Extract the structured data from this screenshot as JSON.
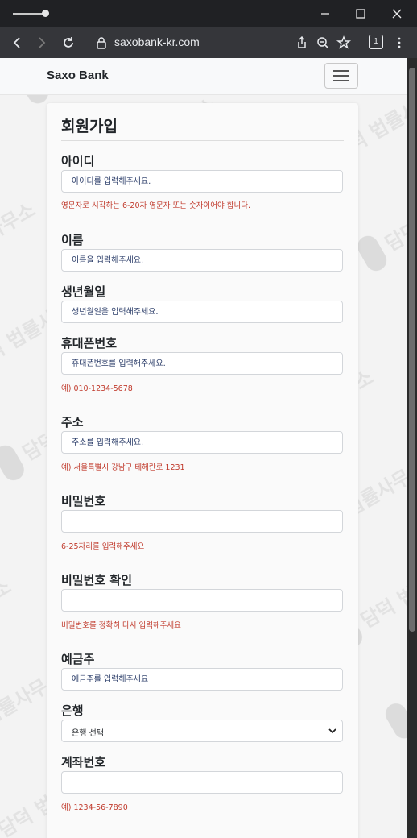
{
  "browser": {
    "url": "saxobank-kr.com",
    "tab_count": "1"
  },
  "navbar": {
    "brand": "Saxo Bank"
  },
  "form": {
    "title": "회원가입",
    "fields": {
      "userid": {
        "label": "아이디",
        "placeholder": "아이디를 입력해주세요.",
        "hint": "영문자로 시작하는 6-20자 영문자 또는 숫자이어야 합니다."
      },
      "name": {
        "label": "이름",
        "placeholder": "이름을 입력해주세요."
      },
      "birth": {
        "label": "생년월일",
        "placeholder": "생년월일을 입력해주세요."
      },
      "phone": {
        "label": "휴대폰번호",
        "placeholder": "휴대폰번호를 입력해주세요.",
        "hint": "예) 010-1234-5678"
      },
      "address": {
        "label": "주소",
        "placeholder": "주소를 입력해주세요.",
        "hint": "예) 서울특별시 강남구 테헤란로 1231"
      },
      "password": {
        "label": "비밀번호",
        "placeholder": "",
        "hint": "6-25자리를 입력해주세요"
      },
      "password_confirm": {
        "label": "비밀번호 확인",
        "placeholder": "",
        "hint": "비밀번호를 정확히 다시 입력해주세요"
      },
      "holder": {
        "label": "예금주",
        "placeholder": "예금주를 입력해주세요"
      },
      "bank": {
        "label": "은행",
        "selected": "은행 선택"
      },
      "account": {
        "label": "계좌번호",
        "placeholder": "",
        "hint": "예) 1234-56-7890"
      }
    }
  },
  "watermark": {
    "text": "담덕 법률사무소"
  },
  "colors": {
    "hint_red": "#c0392b",
    "chrome_dark": "#202124",
    "toolbar": "#35363a"
  }
}
